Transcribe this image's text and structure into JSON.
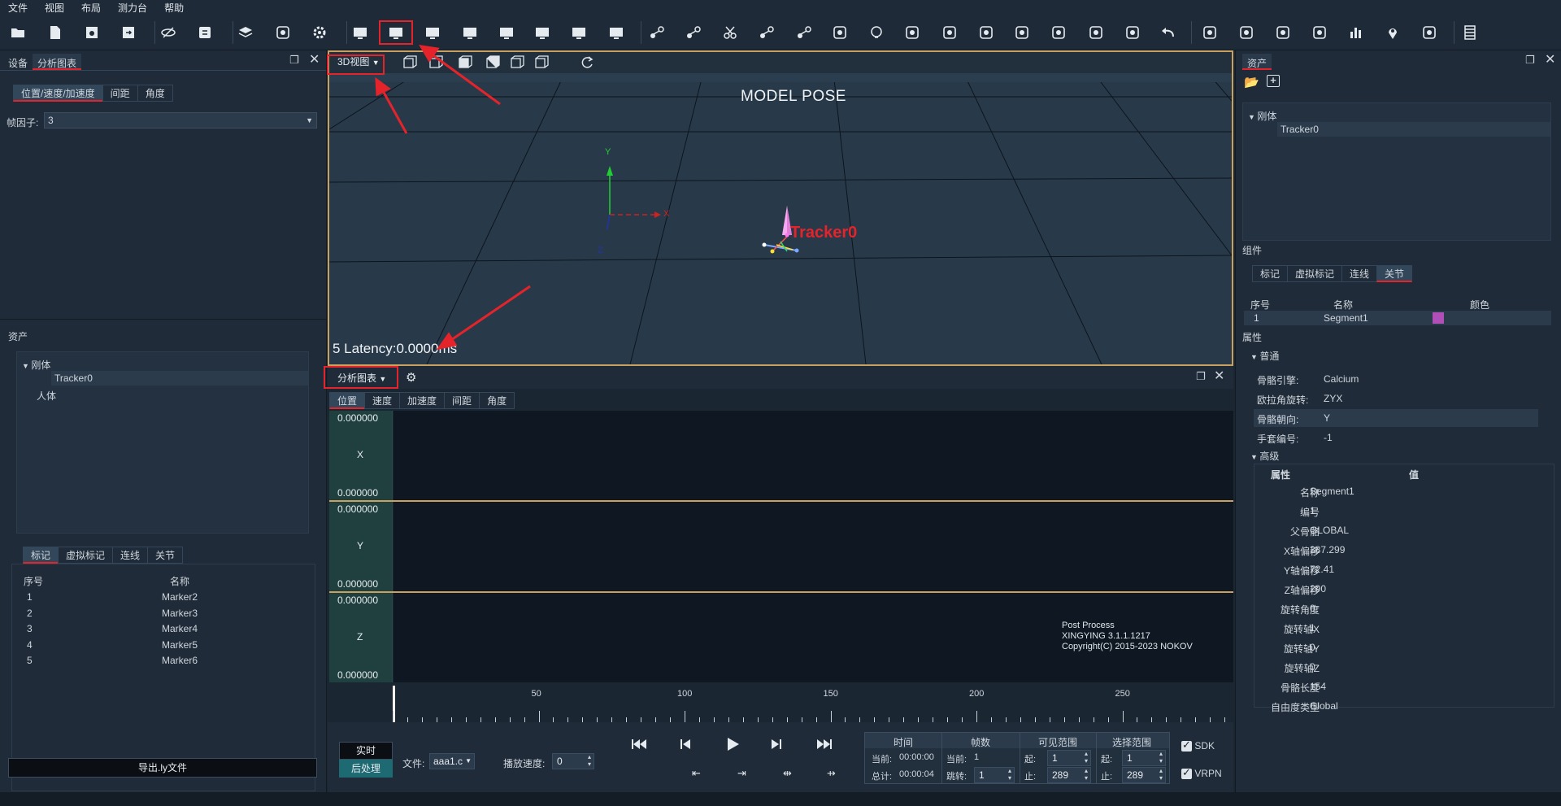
{
  "menu": [
    "文件",
    "视图",
    "布局",
    "测力台",
    "帮助"
  ],
  "toolbar_icons": [
    "open-folder-icon",
    "new-file-icon",
    "save-icon",
    "save-as-icon",
    "hide-icon",
    "sync-icon",
    "layers-icon",
    "wireless-camera-icon",
    "settings-icon",
    "layout-single-icon",
    "layout-top-bottom-icon",
    "layout-left-split-icon",
    "layout-top-split-icon",
    "layout-three-top-icon",
    "layout-three-left-icon",
    "layout-three-right-icon",
    "layout-quad-icon",
    "marker-link-icon",
    "marker-rotate-icon",
    "cut-icon",
    "marker-swap-icon",
    "marker-connect-icon",
    "calculator-icon",
    "circle-icon",
    "delete-marker-icon",
    "smooth-wave-icon",
    "trim-icon",
    "select-region-icon",
    "target-icon",
    "run-icon",
    "chart-line-icon",
    "undo-icon",
    "export-video-icon",
    "3d-icon",
    "gauge-icon",
    "skeleton-icon",
    "bar-chart-icon",
    "location-pin-icon",
    "folder-icon",
    "list-panel-icon"
  ],
  "left_panel": {
    "tabs": [
      "设备",
      "分析图表"
    ],
    "sub_tabs": [
      "位置/速度/加速度",
      "间距",
      "角度"
    ],
    "frame_factor_label": "帧因子:",
    "frame_factor_value": "3",
    "assets_title": "资产",
    "tree": {
      "rigid": "刚体",
      "rigid_item": "Tracker0",
      "human": "人体"
    },
    "marker_tabs": [
      "标记",
      "虚拟标记",
      "连线",
      "关节"
    ],
    "table_headers": [
      "序号",
      "名称"
    ],
    "markers": [
      {
        "id": "1",
        "name": "Marker2"
      },
      {
        "id": "2",
        "name": "Marker3"
      },
      {
        "id": "3",
        "name": "Marker4"
      },
      {
        "id": "4",
        "name": "Marker5"
      },
      {
        "id": "5",
        "name": "Marker6"
      }
    ],
    "export_button": "导出.ly文件"
  },
  "viewport": {
    "view_dropdown": "3D视图",
    "title": "MODEL POSE",
    "tracker_label": "Tracker0",
    "axis_x": "X",
    "axis_y": "Y",
    "axis_z": "Z",
    "latency": "5 Latency:0.0000ms"
  },
  "chart_panel": {
    "dropdown": "分析图表",
    "tabs": [
      "位置",
      "速度",
      "加速度",
      "间距",
      "角度"
    ],
    "rows": [
      {
        "axis": "X",
        "top": "0.000000",
        "bottom": "0.000000"
      },
      {
        "axis": "Y",
        "top": "0.000000",
        "bottom": "0.000000"
      },
      {
        "axis": "Z",
        "top": "0.000000",
        "bottom": "0.000000"
      }
    ],
    "post_process": [
      "Post Process",
      "XINGYING 3.1.1.1217",
      "Copyright(C) 2015-2023 NOKOV"
    ]
  },
  "timeline": {
    "labels": [
      "50",
      "100",
      "150",
      "200",
      "250"
    ]
  },
  "playback": {
    "realtime_button": "实时",
    "postprocess_button": "后处理",
    "file_label": "文件:",
    "file_value": "aaa1.c",
    "speed_label": "播放速度:",
    "speed_value": "0",
    "time_header": "时间",
    "frames_header": "帧数",
    "visible_range_header": "可见范围",
    "select_range_header": "选择范围",
    "current_label": "当前:",
    "total_label": "总计:",
    "current_time": "00:00:00",
    "total_time": "00:00:04",
    "frame_current_label": "当前:",
    "frame_current": "1",
    "jump_label": "跳转:",
    "jump_value": "1",
    "from_label": "起:",
    "to_label": "止:",
    "vis_from": "1",
    "vis_to": "289",
    "sel_from": "1",
    "sel_to": "289",
    "sdk_label": "SDK",
    "vrpn_label": "VRPN"
  },
  "right_panel": {
    "tab": "资产",
    "tree": {
      "rigid": "刚体",
      "item": "Tracker0"
    },
    "components_title": "组件",
    "comp_tabs": [
      "标记",
      "虚拟标记",
      "连线",
      "关节"
    ],
    "comp_headers": [
      "序号",
      "名称",
      "颜色"
    ],
    "segment": {
      "id": "1",
      "name": "Segment1",
      "color": "#b04fb8"
    },
    "props_title": "属性",
    "general_title": "普通",
    "general": [
      {
        "k": "骨骼引擎:",
        "v": "Calcium"
      },
      {
        "k": "欧拉角旋转:",
        "v": "ZYX"
      },
      {
        "k": "骨骼朝向:",
        "v": "Y"
      },
      {
        "k": "手套编号:",
        "v": "-1"
      }
    ],
    "advanced_title": "高级",
    "adv_headers": [
      "属性",
      "值"
    ],
    "advanced": [
      {
        "k": "名称",
        "v": "Segment1"
      },
      {
        "k": "编号",
        "v": "1"
      },
      {
        "k": "父骨骼",
        "v": "GLOBAL"
      },
      {
        "k": "X轴偏移",
        "v": "387.299"
      },
      {
        "k": "Y轴偏移",
        "v": "72.41"
      },
      {
        "k": "Z轴偏移",
        "v": "290"
      },
      {
        "k": "旋转角度",
        "v": "0"
      },
      {
        "k": "旋转轴X",
        "v": "1"
      },
      {
        "k": "旋转轴Y",
        "v": "0"
      },
      {
        "k": "旋转轴Z",
        "v": "0"
      },
      {
        "k": "骨骼长度",
        "v": "154"
      },
      {
        "k": "自由度类型",
        "v": "Global"
      }
    ]
  }
}
